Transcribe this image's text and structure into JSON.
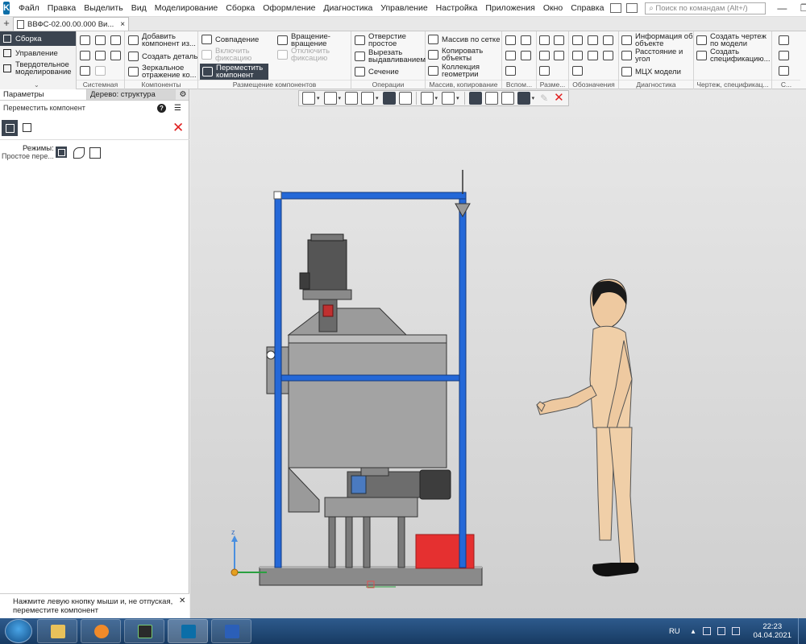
{
  "menu": {
    "items": [
      "Файл",
      "Правка",
      "Выделить",
      "Вид",
      "Моделирование",
      "Сборка",
      "Оформление",
      "Диагностика",
      "Управление",
      "Настройка",
      "Приложения",
      "Окно",
      "Справка"
    ],
    "search_placeholder": "Поиск по командам (Alt+/)"
  },
  "document_tab": {
    "title": "ВВФС-02.00.00.000 Ви...",
    "close": "×"
  },
  "ribbon": {
    "side": {
      "items": [
        "Сборка",
        "Управление",
        "Твердотельное моделирование"
      ]
    },
    "groups": {
      "system": "Системная",
      "components": {
        "label": "Компоненты",
        "add": "Добавить компонент из...",
        "create_part": "Создать деталь",
        "mirror": "Зеркальное отражение ко..."
      },
      "placement": {
        "label": "Размещение компонентов",
        "coincidence": "Совпадение",
        "rotation": "Вращение-вращение",
        "enable_fix": "Включить фиксацию",
        "disable_fix": "Отключить фиксацию",
        "move": "Переместить компонент"
      },
      "operations": {
        "label": "Операции",
        "hole": "Отверстие простое",
        "cut_extrude": "Вырезать выдавливанием",
        "section": "Сечение"
      },
      "array": {
        "label": "Массив, копирование",
        "grid": "Массив по сетке",
        "copy": "Копировать объекты",
        "collection": "Коллекция геометрии"
      },
      "auxiliary": "Вспом...",
      "dimensions": "Разме...",
      "annotations": "Обозначения",
      "diagnostics": {
        "label": "Диагностика",
        "info": "Информация об объекте",
        "distance": "Расстояние и угол",
        "mass": "МЦХ модели"
      },
      "drawing": {
        "label": "Чертеж, спецификац...",
        "create_drawing": "Создать чертеж по модели",
        "create_spec": "Создать спецификацию..."
      },
      "last": "С..."
    }
  },
  "panel": {
    "tab_parameters": "Параметры",
    "tab_tree": "Дерево: структура",
    "subtitle": "Переместить компонент",
    "modes_label": "Режимы:",
    "mode_value": "Простое пере...",
    "status_message": "Нажмите левую кнопку мыши и, не отпуская, переместите компонент"
  },
  "viewport": {
    "axis_z": "z"
  },
  "taskbar": {
    "apps": [
      "explorer",
      "media-player",
      "terminal",
      "kompas-3d",
      "word"
    ],
    "lang": "RU",
    "time": "22:23",
    "date": "04.04.2021"
  },
  "colors": {
    "frame_blue": "#2468d8",
    "accent_dark": "#3b4450",
    "red_box": "#e53030",
    "machine_gray": "#8c8c8c",
    "skin": "#eec9a0",
    "cancel_red": "#e02020"
  }
}
